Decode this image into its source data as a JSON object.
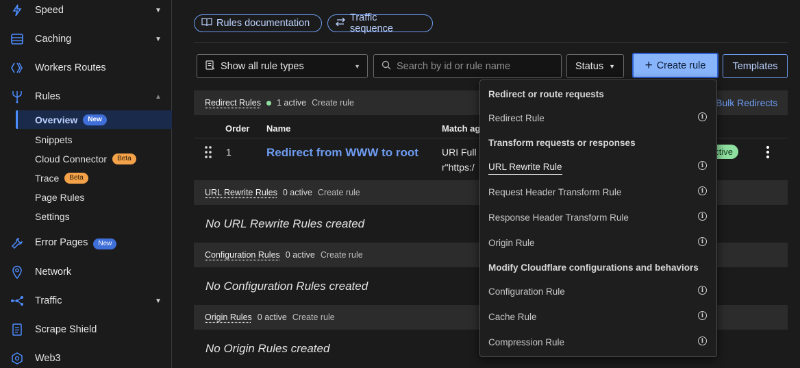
{
  "sidebar": {
    "items": [
      {
        "label": "Speed",
        "icon": "lightning-icon"
      },
      {
        "label": "Caching",
        "icon": "database-icon"
      },
      {
        "label": "Workers Routes",
        "icon": "workers-icon"
      },
      {
        "label": "Rules",
        "icon": "rules-fork-icon"
      },
      {
        "label": "Error Pages",
        "icon": "wrench-icon",
        "badge": "New"
      },
      {
        "label": "Network",
        "icon": "location-pin-icon"
      },
      {
        "label": "Traffic",
        "icon": "traffic-nodes-icon"
      },
      {
        "label": "Scrape Shield",
        "icon": "document-shield-icon"
      },
      {
        "label": "Web3",
        "icon": "web3-icon"
      }
    ],
    "rules_sub": [
      {
        "label": "Overview",
        "badge": "New"
      },
      {
        "label": "Snippets"
      },
      {
        "label": "Cloud Connector",
        "badge": "Beta"
      },
      {
        "label": "Trace",
        "badge": "Beta"
      },
      {
        "label": "Page Rules"
      },
      {
        "label": "Settings"
      }
    ]
  },
  "top_links": {
    "docs": "Rules documentation",
    "traffic": "Traffic sequence"
  },
  "toolbar": {
    "rule_type": "Show all rule types",
    "search_placeholder": "Search by id or rule name",
    "status": "Status",
    "create": "Create rule",
    "templates": "Templates"
  },
  "sections": {
    "redirect": {
      "title": "Redirect Rules",
      "count": "1 active",
      "create": "Create rule",
      "bulk": "Bulk Redirects"
    },
    "url_rewrite": {
      "title": "URL Rewrite Rules",
      "count": "0 active",
      "create": "Create rule",
      "empty": "No URL Rewrite Rules created"
    },
    "configuration": {
      "title": "Configuration Rules",
      "count": "0 active",
      "create": "Create rule",
      "empty": "No Configuration Rules created"
    },
    "origin": {
      "title": "Origin Rules",
      "count": "0 active",
      "create": "Create rule",
      "empty": "No Origin Rules created"
    }
  },
  "table": {
    "headers": {
      "order": "Order",
      "name": "Name",
      "match": "Match ag"
    },
    "row": {
      "order": "1",
      "name": "Redirect from WWW to root",
      "match_line1": "URI Full",
      "match_line2": "r\"https:/",
      "status": "ctive"
    }
  },
  "dropdown": {
    "group1": "Redirect or route requests",
    "redirect_rule": "Redirect Rule",
    "group2": "Transform requests or responses",
    "url_rewrite_rule": "URL Rewrite Rule",
    "request_header_rule": "Request Header Transform Rule",
    "response_header_rule": "Response Header Transform Rule",
    "origin_rule": "Origin Rule",
    "group3": "Modify Cloudflare configurations and behaviors",
    "configuration_rule": "Configuration Rule",
    "cache_rule": "Cache Rule",
    "compression_rule": "Compression Rule"
  },
  "colors": {
    "accent": "#4d8dff",
    "primary_button": "#87b4fb",
    "badge_new": "#3f6fd8",
    "badge_beta": "#f4a24a",
    "active_green": "#8fe0a0"
  }
}
